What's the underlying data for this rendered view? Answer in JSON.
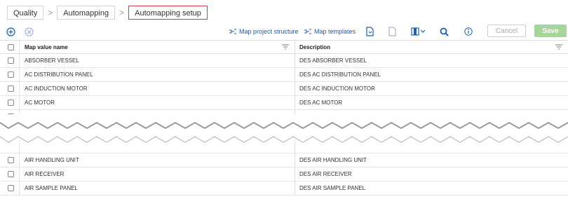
{
  "breadcrumb": {
    "items": [
      "Quality",
      "Automapping",
      "Automapping setup"
    ],
    "separator": ">"
  },
  "toolbar": {
    "map_project_structure": "Map project structure",
    "map_templates": "Map templates",
    "cancel": "Cancel",
    "save": "Save"
  },
  "table": {
    "headers": {
      "name": "Map value name",
      "description": "Description"
    },
    "rows_top": [
      {
        "name": "ABSORBER VESSEL",
        "description": "DES ABSORBER VESSEL"
      },
      {
        "name": "AC DISTRIBUTION PANEL",
        "description": "DES AC DISTRIBUTION PANEL"
      },
      {
        "name": "AC INDUCTION MOTOR",
        "description": "DES AC INDUCTION MOTOR"
      },
      {
        "name": "AC MOTOR",
        "description": "DES AC MOTOR"
      }
    ],
    "rows_bottom": [
      {
        "name": "AIR HANDLING UNIT",
        "description": "DES AIR HANDLING UNIT"
      },
      {
        "name": "AIR RECEIVER",
        "description": "DES AIR RECEIVER"
      },
      {
        "name": "AIR SAMPLE PANEL",
        "description": "DES AIR SAMPLE PANEL"
      }
    ]
  },
  "colors": {
    "accent": "#1a5fb4",
    "active_border": "#d9393c",
    "save_bg": "#a5d59b"
  }
}
